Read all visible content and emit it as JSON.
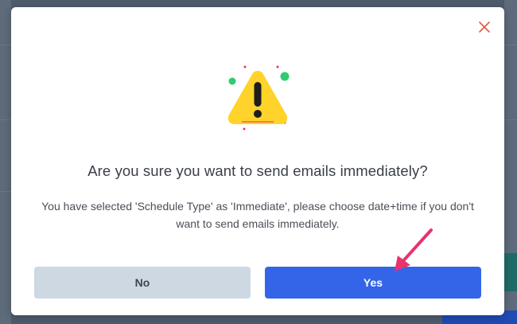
{
  "dialog": {
    "title": "Are you sure you want to send emails immediately?",
    "message": "You have selected 'Schedule Type' as 'Immediate', please choose date+time if you don't want to send emails immediately.",
    "icon": "warning-icon",
    "close_icon": "close-icon",
    "buttons": {
      "no_label": "No",
      "yes_label": "Yes"
    }
  },
  "colors": {
    "accent": "#3465e9",
    "secondary_button": "#cdd8e3",
    "warning": "#ffd32a",
    "close": "#e05a47",
    "annotation_arrow": "#e8336d"
  }
}
